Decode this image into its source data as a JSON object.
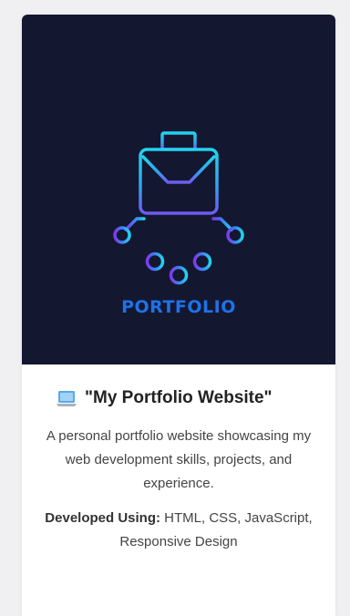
{
  "hero": {
    "label": "PORTFOLIO",
    "background": "#141730",
    "icon": "briefcase-network-icon"
  },
  "project": {
    "icon": "laptop-icon",
    "title": "\"My Portfolio Website\"",
    "description": "A personal portfolio website showcasing my web development skills, projects, and experience.",
    "tech_label": "Developed Using:",
    "tech_value": "HTML, CSS, JavaScript, Responsive Design"
  },
  "colors": {
    "accent": "#1e72e8",
    "gradient_start": "#22d3ee",
    "gradient_end": "#6d28d9"
  }
}
